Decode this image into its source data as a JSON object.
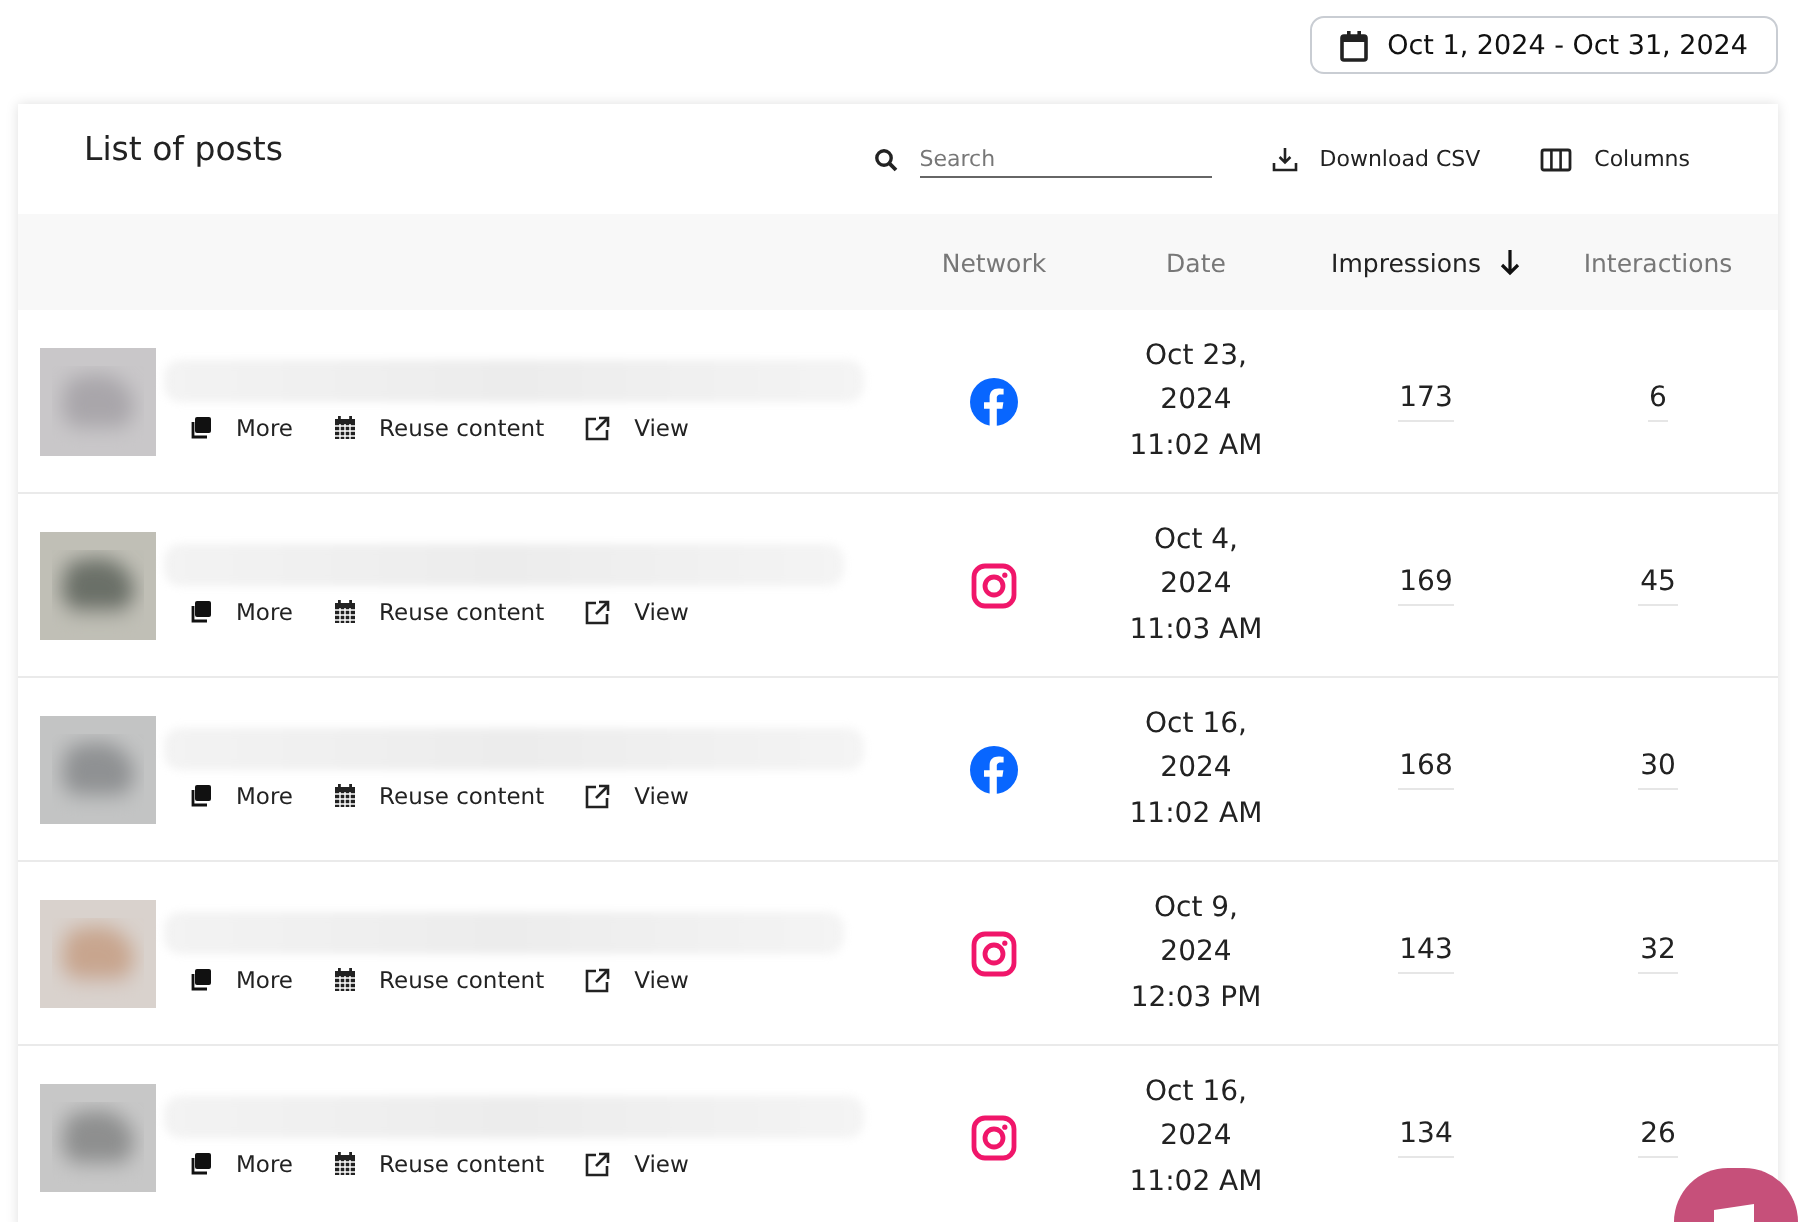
{
  "date_range": "Oct 1, 2024 - Oct 31, 2024",
  "card": {
    "title": "List of posts",
    "search": {
      "placeholder": "Search"
    },
    "tools": [
      {
        "kind": "download",
        "label": "Download CSV"
      },
      {
        "kind": "columns",
        "label": "Columns"
      }
    ]
  },
  "table": {
    "columns": [
      {
        "label": "Network",
        "sorted": false
      },
      {
        "label": "Date",
        "sorted": false
      },
      {
        "label": "Impressions",
        "sorted": true
      },
      {
        "label": "Interactions",
        "sorted": false
      }
    ],
    "rows": [
      {
        "kind": "facebook",
        "date": "Oct 23,",
        "year": "2024",
        "time": "11:02 AM",
        "impressions": "173",
        "interactions": "6",
        "actions": [
          {
            "kind": "more",
            "label": "More"
          },
          {
            "kind": "reuse",
            "label": "Reuse content"
          },
          {
            "kind": "view",
            "label": "View"
          }
        ]
      },
      {
        "kind": "instagram",
        "date": "Oct 4,",
        "year": "2024",
        "time": "11:03 AM",
        "impressions": "169",
        "interactions": "45",
        "actions": [
          {
            "kind": "more",
            "label": "More"
          },
          {
            "kind": "reuse",
            "label": "Reuse content"
          },
          {
            "kind": "view",
            "label": "View"
          }
        ]
      },
      {
        "kind": "facebook",
        "date": "Oct 16,",
        "year": "2024",
        "time": "11:02 AM",
        "impressions": "168",
        "interactions": "30",
        "actions": [
          {
            "kind": "more",
            "label": "More"
          },
          {
            "kind": "reuse",
            "label": "Reuse content"
          },
          {
            "kind": "view",
            "label": "View"
          }
        ]
      },
      {
        "kind": "instagram",
        "date": "Oct 9,",
        "year": "2024",
        "time": "12:03 PM",
        "impressions": "143",
        "interactions": "32",
        "actions": [
          {
            "kind": "more",
            "label": "More"
          },
          {
            "kind": "reuse",
            "label": "Reuse content"
          },
          {
            "kind": "view",
            "label": "View"
          }
        ]
      },
      {
        "kind": "instagram",
        "date": "Oct 16,",
        "year": "2024",
        "time": "11:02 AM",
        "impressions": "134",
        "interactions": "26",
        "actions": [
          {
            "kind": "more",
            "label": "More"
          },
          {
            "kind": "reuse",
            "label": "Reuse content"
          },
          {
            "kind": "view",
            "label": "View"
          }
        ]
      }
    ]
  }
}
